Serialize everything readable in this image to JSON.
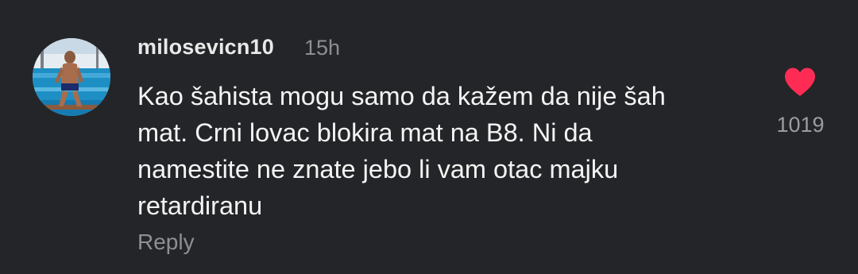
{
  "comment": {
    "username": "milosevicn10",
    "timestamp": "15h",
    "text_lines": [
      "Kao šahista mogu samo da kažem da nije šah",
      "mat. Crni lovac blokira mat na B8. Ni da",
      "namestite ne znate jebo li vam otac majku",
      "retardiranu"
    ],
    "reply_label": "Reply",
    "like_count": "1019",
    "like_icon": "heart-icon",
    "colors": {
      "background": "#242528",
      "heart": "#fe2c55",
      "secondary_text": "#8d8e92"
    }
  }
}
